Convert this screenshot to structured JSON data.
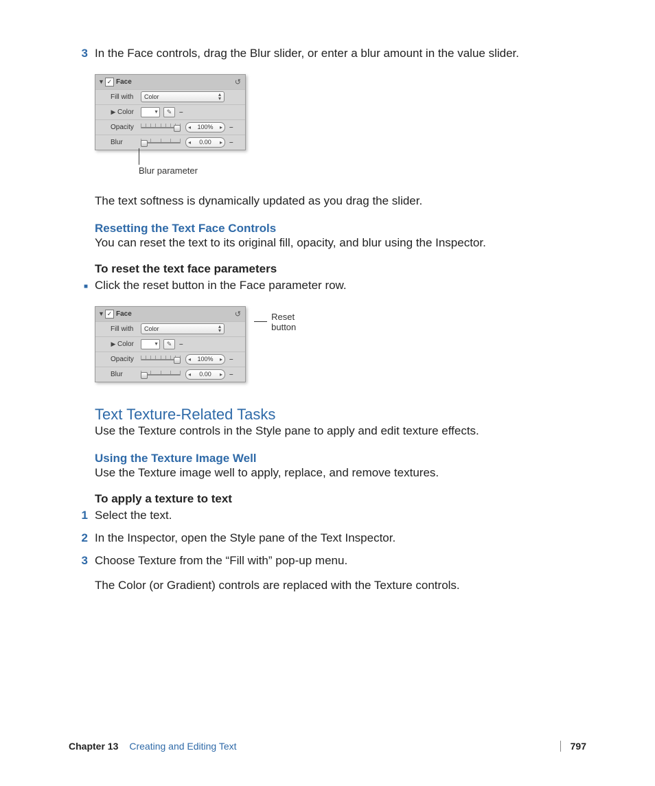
{
  "step3_num": "3",
  "step3_text": "In the Face controls, drag the Blur slider, or enter a blur amount in the value slider.",
  "panel": {
    "face_label": "Face",
    "fillwith_label": "Fill with",
    "fillwith_value": "Color",
    "color_label": "Color",
    "opacity_label": "Opacity",
    "opacity_value": "100%",
    "blur_label": "Blur",
    "blur_value": "0.00"
  },
  "callout_blur": "Blur parameter",
  "callout_reset": "Reset button",
  "after_panel_text": "The text softness is dynamically updated as you drag the slider.",
  "h_reset": "Resetting the Text Face Controls",
  "reset_body": "You can reset the text to its original fill, opacity, and blur using the Inspector.",
  "h_reset_steps": "To reset the text face parameters",
  "reset_step_text": "Click the reset button in the Face parameter row.",
  "h_section": "Text Texture-Related Tasks",
  "section_body": "Use the Texture controls in the Style pane to apply and edit texture effects.",
  "h_texture_well": "Using the Texture Image Well",
  "texture_well_body": "Use the Texture image well to apply, replace, and remove textures.",
  "h_apply_texture": "To apply a texture to text",
  "steps": {
    "s1_num": "1",
    "s1_text": "Select the text.",
    "s2_num": "2",
    "s2_text": "In the Inspector, open the Style pane of the Text Inspector.",
    "s3_num": "3",
    "s3_text": "Choose Texture from the “Fill with” pop-up menu."
  },
  "after_steps": "The Color (or Gradient) controls are replaced with the Texture controls.",
  "footer": {
    "chapter": "Chapter 13",
    "title": "Creating and Editing Text",
    "page": "797"
  }
}
